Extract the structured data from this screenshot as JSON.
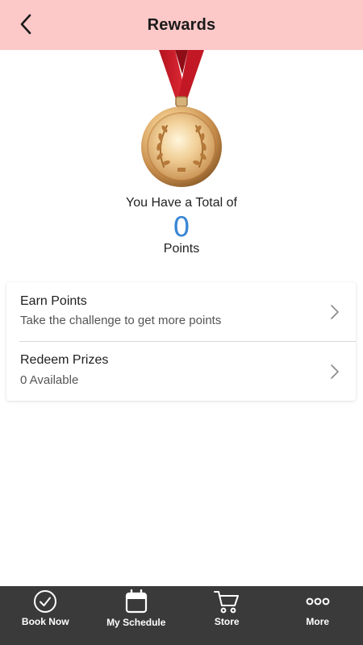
{
  "header": {
    "title": "Rewards",
    "bg_color": "#fcc8c8"
  },
  "summary": {
    "label": "You Have a Total of",
    "points": "0",
    "unit": "Points",
    "points_color": "#3a86d4"
  },
  "menu": {
    "items": [
      {
        "title": "Earn Points",
        "subtitle": "Take the challenge to get more points",
        "icon": "chevron-right-icon"
      },
      {
        "title": "Redeem Prizes",
        "subtitle": "0 Available",
        "icon": "chevron-right-icon"
      }
    ]
  },
  "tabbar": {
    "bg_color": "#3a3a3a",
    "tabs": [
      {
        "label": "Book Now",
        "icon": "check-circle-icon"
      },
      {
        "label": "My Schedule",
        "icon": "calendar-icon"
      },
      {
        "label": "Store",
        "icon": "cart-icon"
      },
      {
        "label": "More",
        "icon": "more-dots-icon"
      }
    ]
  }
}
